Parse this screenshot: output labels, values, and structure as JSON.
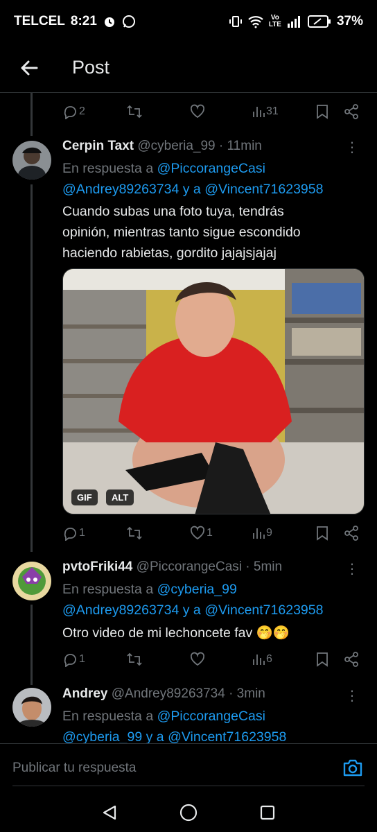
{
  "status_bar": {
    "carrier": "TELCEL",
    "time": "8:21",
    "volte": "Vo",
    "lte": "LTE",
    "battery": "37%"
  },
  "header": {
    "title": "Post"
  },
  "top_actions": {
    "replies": "2",
    "retweets": "",
    "likes": "",
    "views": "31"
  },
  "tweets": [
    {
      "name": "Cerpin Taxt",
      "handle": "@cyberia_99",
      "time": "· 11min",
      "reply_prefix": "En respuesta a",
      "reply_mention1": "@PiccorangeCasi",
      "reply_mention2": "@Andrey89263734",
      "reply_mid": "y a",
      "reply_mention3": "@Vincent71623958",
      "text_line1": "Cuando subas una foto tuya, tendrás",
      "text_line2": "opinión, mientras tanto sigue escondido",
      "text_line3": "haciendo rabietas, gordito jajajsjajaj",
      "badge_gif": "GIF",
      "badge_alt": "ALT",
      "actions": {
        "replies": "1",
        "retweets": "",
        "likes": "1",
        "views": "9"
      }
    },
    {
      "name": "pvtoFriki44",
      "handle": "@PiccorangeCasi",
      "time": "· 5min",
      "reply_prefix": "En respuesta a",
      "reply_mention1": "@cyberia_99",
      "reply_mention2": "@Andrey89263734",
      "reply_mid": "y a",
      "reply_mention3": "@Vincent71623958",
      "text_line1": "Otro video de mi lechoncete fav 🤭🤭",
      "actions": {
        "replies": "1",
        "retweets": "",
        "likes": "",
        "views": "6"
      }
    },
    {
      "name": "Andrey",
      "handle": "@Andrey89263734",
      "time": "· 3min",
      "reply_prefix": "En respuesta a",
      "reply_mention1": "@PiccorangeCasi",
      "reply_mention2": "@cyberia_99",
      "reply_mid": "y a",
      "reply_mention3": "@Vincent71623958"
    }
  ],
  "composer": {
    "placeholder": "Publicar tu respuesta"
  },
  "icons": {
    "back": "arrow-left-icon",
    "reply": "reply-icon",
    "retweet": "retweet-icon",
    "like": "heart-icon",
    "views": "views-icon",
    "bookmark": "bookmark-icon",
    "share": "share-icon",
    "camera": "camera-icon"
  },
  "colors": {
    "background": "#000000",
    "text": "#e7e9ea",
    "muted": "#71767b",
    "link": "#1d9bf0",
    "divider": "#2f3336"
  }
}
